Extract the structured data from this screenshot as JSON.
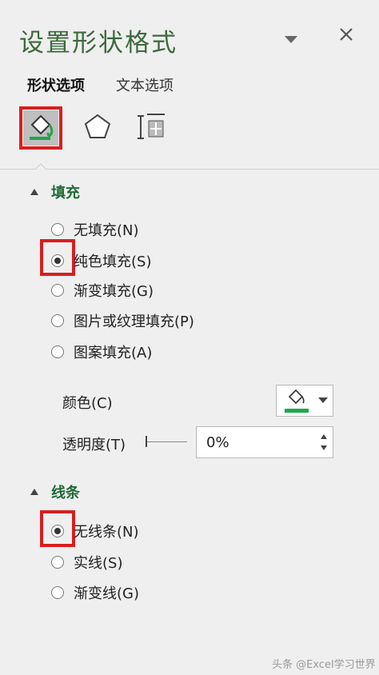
{
  "panel": {
    "title": "设置形状格式",
    "dropdown_icon": "chevron-down-icon",
    "close_icon": "close-icon"
  },
  "tabs": [
    {
      "label": "形状选项",
      "active": true
    },
    {
      "label": "文本选项",
      "active": false
    }
  ],
  "category_icons": [
    "fill-line-icon",
    "effects-pentagon-icon",
    "size-properties-icon"
  ],
  "fill_section": {
    "header": "填充",
    "options": [
      {
        "label": "无填充(N)",
        "checked": false
      },
      {
        "label": "纯色填充(S)",
        "checked": true
      },
      {
        "label": "渐变填充(G)",
        "checked": false
      },
      {
        "label": "图片或纹理填充(P)",
        "checked": false
      },
      {
        "label": "图案填充(A)",
        "checked": false
      }
    ],
    "color_label": "颜色(C)",
    "color_swatch": "#1ea84a",
    "transparency_label": "透明度(T)",
    "transparency_value": "0%"
  },
  "line_section": {
    "header": "线条",
    "options": [
      {
        "label": "无线条(N)",
        "checked": true
      },
      {
        "label": "实线(S)",
        "checked": false
      },
      {
        "label": "渐变线(G)",
        "checked": false
      }
    ]
  },
  "colors": {
    "accent_green": "#1f6b35",
    "highlight_red": "#d81e1e"
  },
  "watermark": "头条 @Excel学习世界"
}
